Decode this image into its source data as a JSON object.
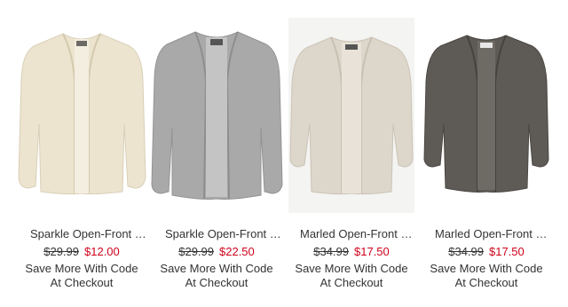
{
  "products": [
    {
      "name": "Sparkle Open-Front Cardigan for Girls",
      "original_price": "$29.99",
      "sale_price": "$12.00",
      "promo_line1": "Save More With Code",
      "promo_line2": "At Checkout",
      "image_alt": "cream sparkle open-front cardigan"
    },
    {
      "name": "Sparkle Open-Front Cardigan for Girls",
      "original_price": "$29.99",
      "sale_price": "$22.50",
      "promo_line1": "Save More With Code",
      "promo_line2": "At Checkout",
      "image_alt": "gray sparkle open-front cardigan"
    },
    {
      "name": "Marled Open-Front Cardigan for Girls",
      "original_price": "$34.99",
      "sale_price": "$17.50",
      "promo_line1": "Save More With Code",
      "promo_line2": "At Checkout",
      "image_alt": "oatmeal marled open-front cardigan"
    },
    {
      "name": "Marled Open-Front Cardigan for Girls",
      "original_price": "$34.99",
      "sale_price": "$17.50",
      "promo_line1": "Save More With Code",
      "promo_line2": "At Checkout",
      "image_alt": "charcoal marled open-front cardigan"
    }
  ],
  "colors": {
    "sale_red": "#d0021b",
    "text_gray": "#333333",
    "cardigan_cream": "#ece4cf",
    "cardigan_gray": "#a9a9a9",
    "cardigan_oatmeal": "#ddd6cb",
    "cardigan_charcoal": "#5e5a55"
  }
}
